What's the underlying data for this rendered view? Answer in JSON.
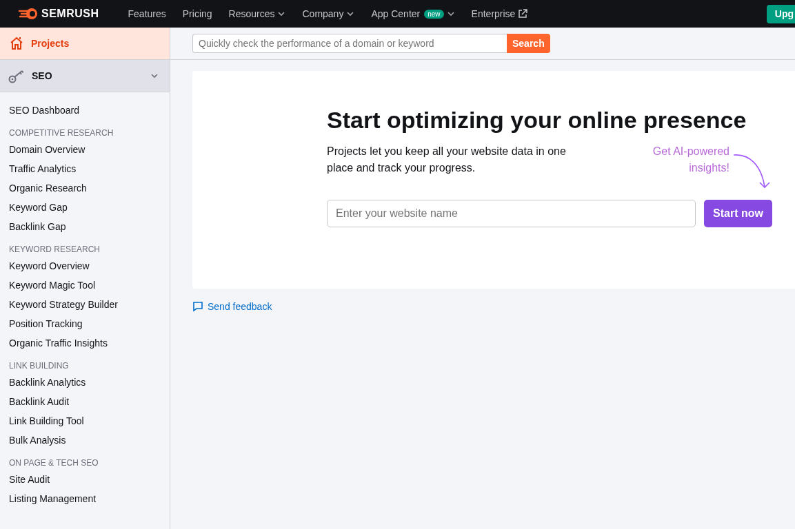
{
  "topbar": {
    "logo": "SEMRUSH",
    "nav": [
      {
        "label": "Features",
        "dropdown": false,
        "external": false
      },
      {
        "label": "Pricing",
        "dropdown": false,
        "external": false
      },
      {
        "label": "Resources",
        "dropdown": true,
        "external": false
      },
      {
        "label": "Company",
        "dropdown": true,
        "external": false
      },
      {
        "label": "App Center",
        "badge": "new",
        "dropdown": true,
        "external": false
      },
      {
        "label": "Enterprise",
        "dropdown": false,
        "external": true
      }
    ],
    "upgrade_button": "Upg"
  },
  "sidebar": {
    "projects": {
      "label": "Projects",
      "selected": true
    },
    "seo": {
      "label": "SEO",
      "expanded": true
    },
    "groups": [
      {
        "items": [
          "SEO Dashboard"
        ]
      },
      {
        "heading": "COMPETITIVE RESEARCH",
        "items": [
          "Domain Overview",
          "Traffic Analytics",
          "Organic Research",
          "Keyword Gap",
          "Backlink Gap"
        ]
      },
      {
        "heading": "KEYWORD RESEARCH",
        "items": [
          "Keyword Overview",
          "Keyword Magic Tool",
          "Keyword Strategy Builder",
          "Position Tracking",
          "Organic Traffic Insights"
        ]
      },
      {
        "heading": "LINK BUILDING",
        "items": [
          "Backlink Analytics",
          "Backlink Audit",
          "Link Building Tool",
          "Bulk Analysis"
        ]
      },
      {
        "heading": "ON PAGE & TECH SEO",
        "items": [
          "Site Audit",
          "Listing Management"
        ]
      }
    ]
  },
  "search": {
    "placeholder": "Quickly check the performance of a domain or keyword",
    "button": "Search"
  },
  "hero": {
    "title": "Start optimizing your online presence",
    "text": "Projects let you keep all your website data in one place and track your progress.",
    "ai_hint": "Get AI-powered insights!",
    "placeholder": "Enter your website name",
    "button": "Start now"
  },
  "feedback": "Send feedback"
}
